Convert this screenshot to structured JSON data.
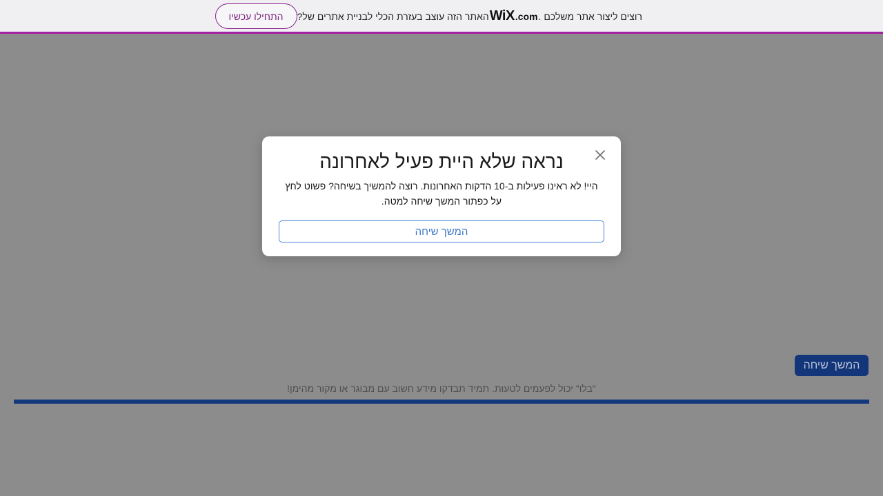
{
  "wix_banner": {
    "text_before_logo": "?האתר הזה עוצב בעזרת הכלי לבניית אתרים של ",
    "logo_brand": "WiX",
    "logo_suffix": ".com",
    "text_after_logo": ". רוצים ליצור אתר משלכם",
    "start_button_label": "התחילו עכשיו",
    "accent_color": "#a31fa3"
  },
  "page": {
    "continue_chat_label": "המשך שיחה",
    "disclaimer": "\"בלו\" יכול לפעמים לטעות. תמיד תבדקו מידע חשוב עם מבוגר או מקור מהימן!",
    "bar_color": "#14387e"
  },
  "modal": {
    "title": "נראה שלא היית פעיל לאחרונה",
    "body": "היי! לא ראינו פעילות ב-10 הדקות האחרונות. רוצה להמשיך בשיחה? פשוט לחץ על כפתור המשך שיחה למטה.",
    "continue_button_label": "המשך שיחה",
    "close_icon": "close-icon"
  }
}
